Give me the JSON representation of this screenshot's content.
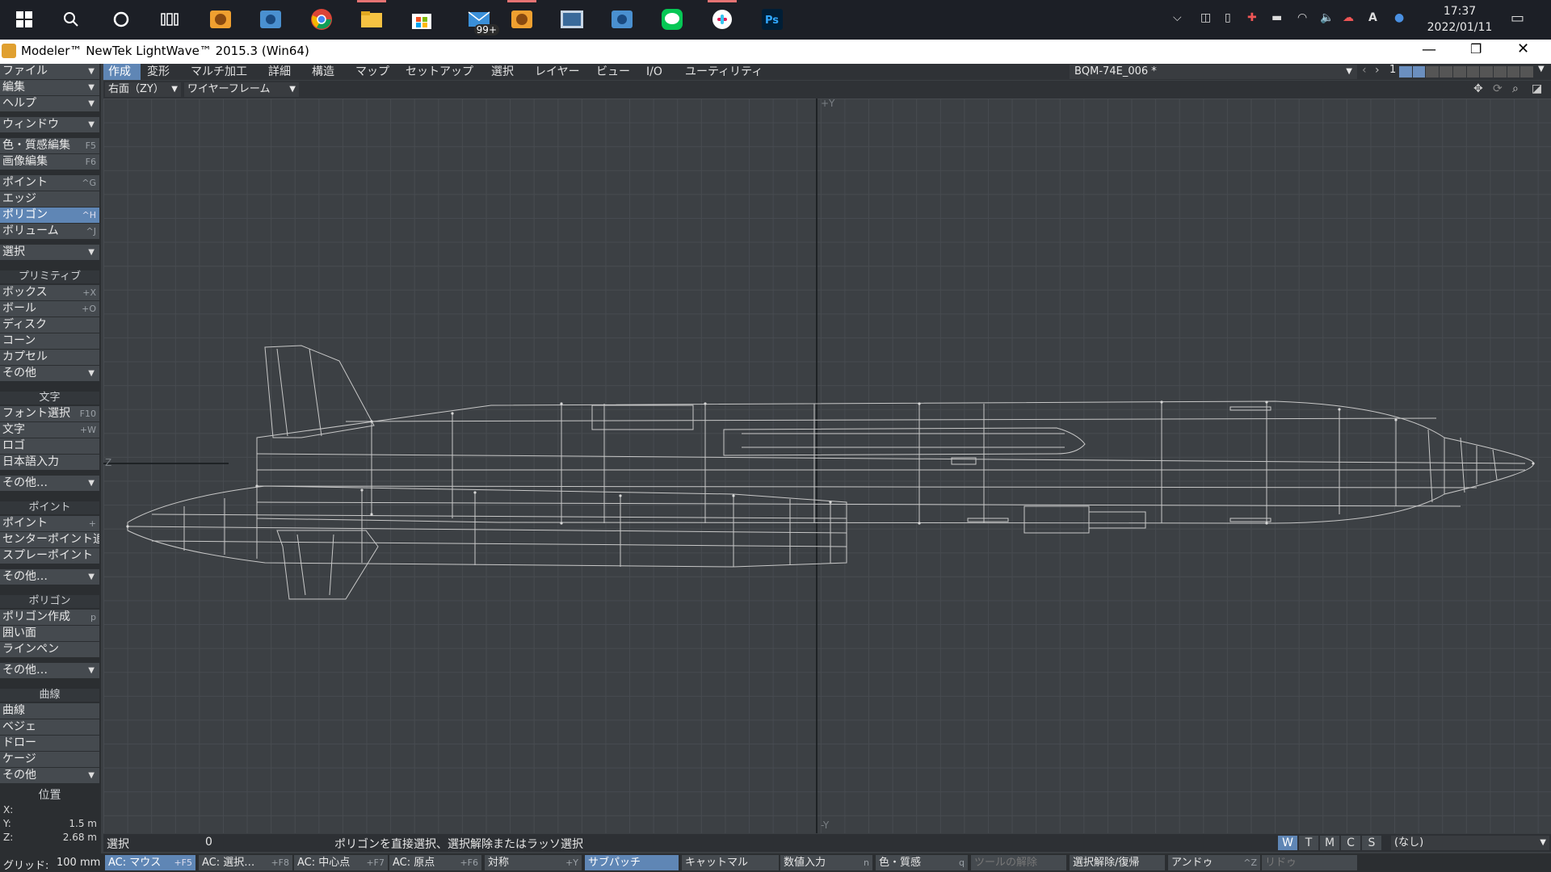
{
  "taskbar": {
    "clock_time": "17:37",
    "clock_date": "2022/01/11",
    "mail_badge": "99+",
    "ime_label": "A"
  },
  "titlebar": {
    "title": "Modeler™ NewTek LightWave™ 2015.3 (Win64)"
  },
  "left_panel": {
    "file": "ファイル",
    "edit": "編集",
    "help": "ヘルプ",
    "window": "ウィンドウ",
    "surface_edit": "色・質感編集",
    "surface_edit_sc": "F5",
    "image_edit": "画像編集",
    "image_edit_sc": "F6",
    "point": "ポイント",
    "point_sc": "^G",
    "edge": "エッジ",
    "polygon": "ポリゴン",
    "polygon_sc": "^H",
    "volume": "ボリューム",
    "volume_sc": "^J",
    "select": "選択",
    "primitive_header": "プリミティブ",
    "box": "ボックス",
    "box_sc": "+X",
    "ball": "ボール",
    "ball_sc": "+O",
    "disc": "ディスク",
    "cone": "コーン",
    "capsule": "カプセル",
    "other1": "その他",
    "text_header": "文字",
    "font_select": "フォント選択",
    "font_select_sc": "F10",
    "text": "文字",
    "text_sc": "+W",
    "logo": "ロゴ",
    "japanese_input": "日本語入力",
    "other2": "その他…",
    "point_header": "ポイント",
    "point_tool": "ポイント",
    "point_tool_sc": "+",
    "center_point": "センターポイント追加",
    "spray_point": "スプレーポイント",
    "other3": "その他…",
    "polygon_header": "ポリゴン",
    "make_polygon": "ポリゴン作成",
    "make_polygon_sc": "p",
    "pen": "囲い面",
    "line_pen": "ラインペン",
    "other4": "その他…",
    "curve_header": "曲線",
    "curve": "曲線",
    "bezier": "ベジェ",
    "draw": "ドロー",
    "cage": "ケージ",
    "other5": "その他",
    "position_header": "位置",
    "pos_x_label": "X:",
    "pos_y_label": "Y:",
    "pos_y_value": "1.5 m",
    "pos_z_label": "Z:",
    "pos_z_value": "2.68 m"
  },
  "tabs": [
    "作成",
    "変形",
    "マルチ加工",
    "詳細",
    "構造",
    "マップ",
    "セットアップ",
    "選択",
    "レイヤー",
    "ビュー",
    "I/O",
    "ユーティリティ"
  ],
  "layer_select": "BQM-74E_006 *",
  "layer_number": "1",
  "view": {
    "view_mode": "右面（ZY）",
    "render_mode": "ワイヤーフレーム",
    "axis_plus_y": "+Y",
    "axis_minus_y": "-Y",
    "axis_z": "Z"
  },
  "statusbar": {
    "select_label": "選択",
    "select_count": "0",
    "hint": "ポリゴンを直接選択、選択解除またはラッソ選択",
    "wtmcs": [
      "W",
      "T",
      "M",
      "C",
      "S"
    ],
    "none_select": "(なし)"
  },
  "bottombar": {
    "grid_label": "グリッド:",
    "grid_value": "100 mm",
    "ac_mouse": "AC: マウス",
    "ac_mouse_sc": "+F5",
    "ac_select": "AC: 選択…",
    "ac_select_sc": "+F8",
    "ac_center": "AC: 中心点",
    "ac_center_sc": "+F7",
    "ac_origin": "AC: 原点",
    "ac_origin_sc": "+F6",
    "symmetry": "対称",
    "symmetry_sc": "+Y",
    "subpatch": "サブパッチ",
    "catmull": "キャットマル",
    "numeric": "数値入力",
    "numeric_sc": "n",
    "surface": "色・質感",
    "surface_sc": "q",
    "tool_release": "ツールの解除",
    "deselect": "選択解除/復帰",
    "undo": "アンドゥ",
    "undo_sc": "^Z",
    "redo": "リドゥ"
  }
}
